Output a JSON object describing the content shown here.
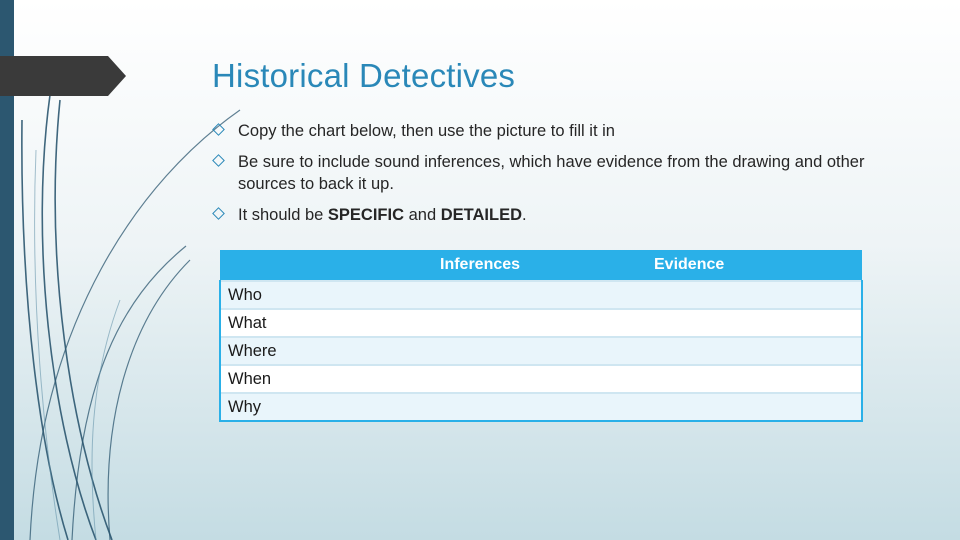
{
  "slide": {
    "title": "Historical Detectives",
    "bullets": [
      "Copy the chart below, then use the picture to fill it in",
      "Be sure to include sound inferences, which have evidence from the drawing and other sources to back it up."
    ],
    "bullet3": {
      "prefix": "It should be ",
      "strong1": "SPECIFIC",
      "mid": " and ",
      "strong2": "DETAILED",
      "suffix": "."
    }
  },
  "chart_data": {
    "type": "table",
    "columns": [
      "",
      "Inferences",
      "Evidence"
    ],
    "rows": [
      [
        "Who",
        "",
        ""
      ],
      [
        "What",
        "",
        ""
      ],
      [
        "Where",
        "",
        ""
      ],
      [
        "When",
        "",
        ""
      ],
      [
        "Why",
        "",
        ""
      ]
    ]
  },
  "colors": {
    "title": "#2a88b8",
    "table_header": "#2ab0e8",
    "left_bar": "#2c5770"
  }
}
